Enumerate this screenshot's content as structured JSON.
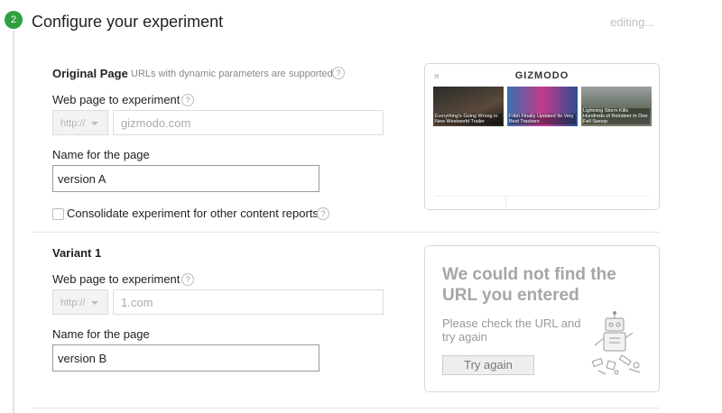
{
  "step": {
    "number": "2",
    "title": "Configure your experiment",
    "status": "editing..."
  },
  "original": {
    "heading": "Original Page",
    "hint": "URLs with dynamic parameters are supported.",
    "url_label": "Web page to experiment",
    "protocol": "http://",
    "url_placeholder": "gizmodo.com",
    "name_label": "Name for the page",
    "name_value": "version A",
    "consolidate_label": "Consolidate experiment for other content reports"
  },
  "preview": {
    "brand": "GIZMODO",
    "articles": [
      {
        "caption": "Everything's Going Wrong in New Westworld Trailer"
      },
      {
        "caption": "Fitbit Finally Updated Its Very Best Trackers"
      },
      {
        "caption": "Lightning Storm Kills Hundreds of Reindeer in One Fell Swoop"
      }
    ]
  },
  "variant": {
    "heading": "Variant 1",
    "url_label": "Web page to experiment",
    "protocol": "http://",
    "url_placeholder": "1.com",
    "name_label": "Name for the page",
    "name_value": "version B"
  },
  "error": {
    "title": "We could not find the URL you entered",
    "message": "Please check the URL and try again",
    "button": "Try again"
  },
  "colors": {
    "accent": "#2ea043",
    "muted": "#a6a6a6"
  },
  "icons": {
    "help": "question-mark-circle",
    "dropdown": "caret-down",
    "robot": "broken-robot-illustration"
  }
}
